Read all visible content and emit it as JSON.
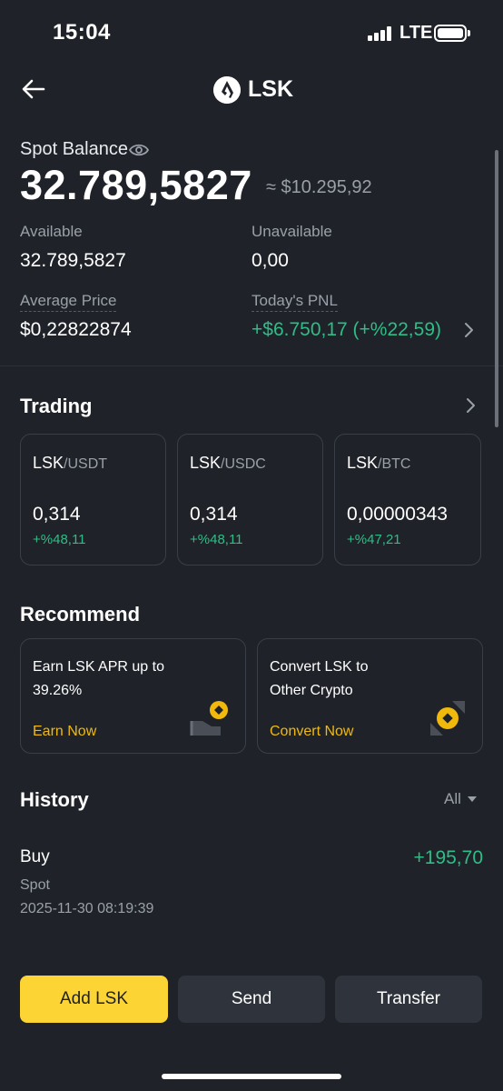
{
  "status_bar": {
    "time": "15:04",
    "network": "LTE"
  },
  "header": {
    "title": "LSK",
    "back_icon": "arrow-left-icon",
    "logo_icon": "lisk-logo-icon"
  },
  "balance": {
    "label": "Spot Balance",
    "eye_icon": "eye-icon",
    "amount": "32.789,5827",
    "approx_value": "≈ $10.295,92",
    "available_label": "Available",
    "available_value": "32.789,5827",
    "unavailable_label": "Unavailable",
    "unavailable_value": "0,00",
    "avg_price_label": "Average Price",
    "avg_price_value": "$0,22822874",
    "pnl_label": "Today's PNL",
    "pnl_value": "+$6.750,17 (+%22,59)"
  },
  "trading": {
    "title": "Trading",
    "pairs": [
      {
        "base": "LSK",
        "quote": "/USDT",
        "price": "0,314",
        "change": "+%48,11"
      },
      {
        "base": "LSK",
        "quote": "/USDC",
        "price": "0,314",
        "change": "+%48,11"
      },
      {
        "base": "LSK",
        "quote": "/BTC",
        "price": "0,00000343",
        "change": "+%47,21"
      }
    ]
  },
  "recommend": {
    "title": "Recommend",
    "cards": [
      {
        "line1": "Earn LSK APR up to",
        "line2": "39.26%",
        "link": "Earn Now",
        "icon": "earn-icon"
      },
      {
        "line1": "Convert LSK to",
        "line2": "Other Crypto",
        "link": "Convert Now",
        "icon": "convert-icon"
      }
    ]
  },
  "history": {
    "title": "History",
    "filter": "All",
    "items": [
      {
        "type": "Buy",
        "account": "Spot",
        "timestamp": "2025-11-30 08:19:39",
        "amount": "+195,70"
      }
    ]
  },
  "actions": {
    "add": "Add LSK",
    "send": "Send",
    "transfer": "Transfer"
  },
  "colors": {
    "background": "#1f2329",
    "accent_yellow": "#fcd535",
    "link_yellow": "#f0b90b",
    "positive_green": "#2ebd85",
    "muted_text": "#9aa0a8"
  }
}
